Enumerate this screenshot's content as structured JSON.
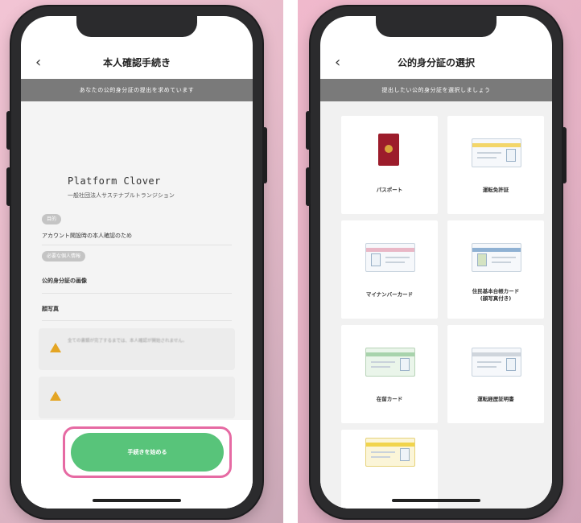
{
  "left_screen": {
    "title": "本人確認手続き",
    "back": "‹",
    "banner": "あなたの公的身分証の提出を求めています",
    "org_name": "Platform Clover",
    "org_sub": "一般社団法人サステナブルトランジション",
    "purpose_tag": "目的",
    "purpose_text": "アカウント開設時の本人確認のため",
    "info_tag": "必要な個人情報",
    "item1": "公的身分証の画像",
    "item2": "顔写真",
    "warning1": "全ての書類が完了するまでは、本人確認が開始されません。",
    "warning2": "",
    "cta_label": "手続きを始める"
  },
  "right_screen": {
    "title": "公的身分証の選択",
    "back": "‹",
    "banner": "提出したい公的身分証を選択しましょう",
    "documents": [
      {
        "label": "パスポート",
        "icon": "passport-icon"
      },
      {
        "label": "運転免許証",
        "icon": "license-icon"
      },
      {
        "label": "マイナンバーカード",
        "icon": "mynumber-card-icon"
      },
      {
        "label": "住民基本台帳カード\n(顔写真付き)",
        "icon": "resident-card-icon"
      },
      {
        "label": "在留カード",
        "icon": "residence-card-icon"
      },
      {
        "label": "運転経歴証明書",
        "icon": "driving-history-icon"
      },
      {
        "label": "",
        "icon": "card-icon"
      }
    ]
  },
  "colors": {
    "accent_green": "#58c47a",
    "highlight_pink": "#e66aa3",
    "banner_gray": "#7a7a7a",
    "warning_yellow": "#e4a524",
    "passport_red": "#9c1c2b"
  }
}
